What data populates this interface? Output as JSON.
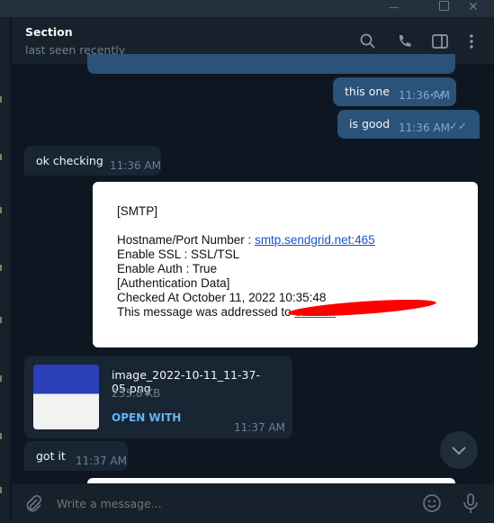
{
  "window": {
    "controls": [
      "minimize",
      "maximize",
      "close"
    ]
  },
  "header": {
    "title": "Section",
    "status": "last seen recently",
    "icons": [
      "search-icon",
      "phone-icon",
      "sidebar-toggle-icon",
      "more-vertical-icon"
    ]
  },
  "messages": [
    {
      "type": "out",
      "text": "this one",
      "time": "11:36 AM"
    },
    {
      "type": "out",
      "text": "is good",
      "time": "11:36 AM"
    },
    {
      "type": "in",
      "text": "ok checking",
      "time": "11:36 AM"
    },
    {
      "type": "image",
      "lines": [
        "[SMTP]",
        "",
        "Hostname/Port Number   : ",
        "Enable SSL  : SSL/TSL",
        "Enable Auth : True",
        "[Authentication Data]",
        "Checked At October 11, 2022 10:35:48",
        "This message was addressed to "
      ],
      "link": "smtp.sendgrid.net:465",
      "redacted_email": "owise..."
    },
    {
      "type": "file",
      "name": "image_2022-10-11_11-37-05.png",
      "size": "233.8 KB",
      "action": "OPEN WITH",
      "time": "11:37 AM"
    },
    {
      "type": "in",
      "text": "got it",
      "time": "11:37 AM"
    }
  ],
  "composer": {
    "placeholder": "Write a message..."
  },
  "colors": {
    "outgoing": "#2b5278",
    "incoming": "#182533",
    "background": "#0e1621",
    "accent": "#5eb5f7"
  }
}
